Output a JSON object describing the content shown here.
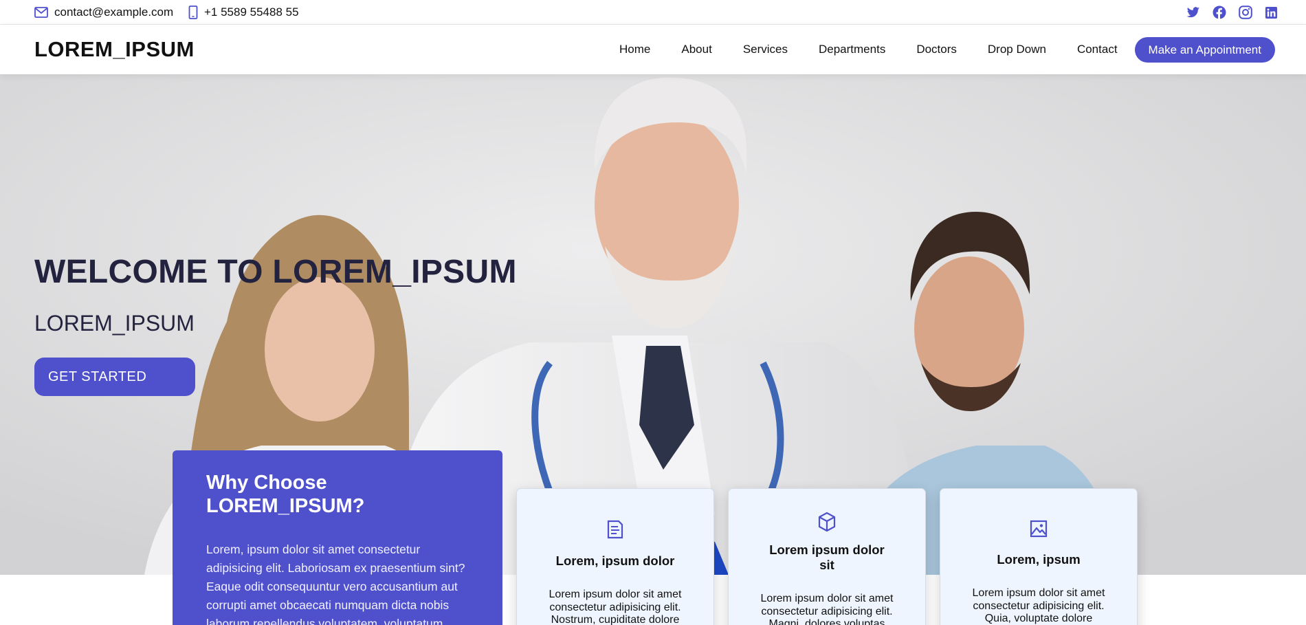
{
  "topbar": {
    "email": "contact@example.com",
    "phone": "+1 5589 55488 55",
    "email_icon": "envelope-icon",
    "phone_icon": "phone-icon",
    "social_icons": [
      "twitter-icon",
      "facebook-icon",
      "instagram-icon",
      "linkedin-icon"
    ]
  },
  "header": {
    "logo": "LOREM_IPSUM",
    "nav": [
      "Home",
      "About",
      "Services",
      "Departments",
      "Doctors",
      "Drop Down",
      "Contact"
    ],
    "appointment_label": "Make an Appointment"
  },
  "hero": {
    "title": "WELCOME TO LOREM_IPSUM",
    "subtitle": "LOREM_IPSUM",
    "cta_label": "GET STARTED"
  },
  "why": {
    "title": "Why Choose LOREM_IPSUM?",
    "text": "Lorem, ipsum dolor sit amet consectetur adipisicing elit. Laboriosam ex praesentium sint? Eaque odit consequuntur vero accusantium aut corrupti amet obcaecati numquam dicta nobis laborum repellendus voluptatem, voluptatum"
  },
  "cards": [
    {
      "icon": "document-icon",
      "title": "Lorem, ipsum dolor",
      "text": "Lorem ipsum dolor sit amet consectetur adipisicing elit. Nostrum, cupiditate dolore"
    },
    {
      "icon": "cube-icon",
      "title": "Lorem ipsum dolor sit",
      "text": "Lorem ipsum dolor sit amet consectetur adipisicing elit. Magni, dolores voluptas"
    },
    {
      "icon": "image-icon",
      "title": "Lorem, ipsum",
      "text": "Lorem ipsum dolor sit amet consectetur adipisicing elit. Quia, voluptate dolore"
    }
  ],
  "colors": {
    "accent": "#4f50cc",
    "hero_text": "#23233f",
    "card_bg": "#eef5fe"
  }
}
